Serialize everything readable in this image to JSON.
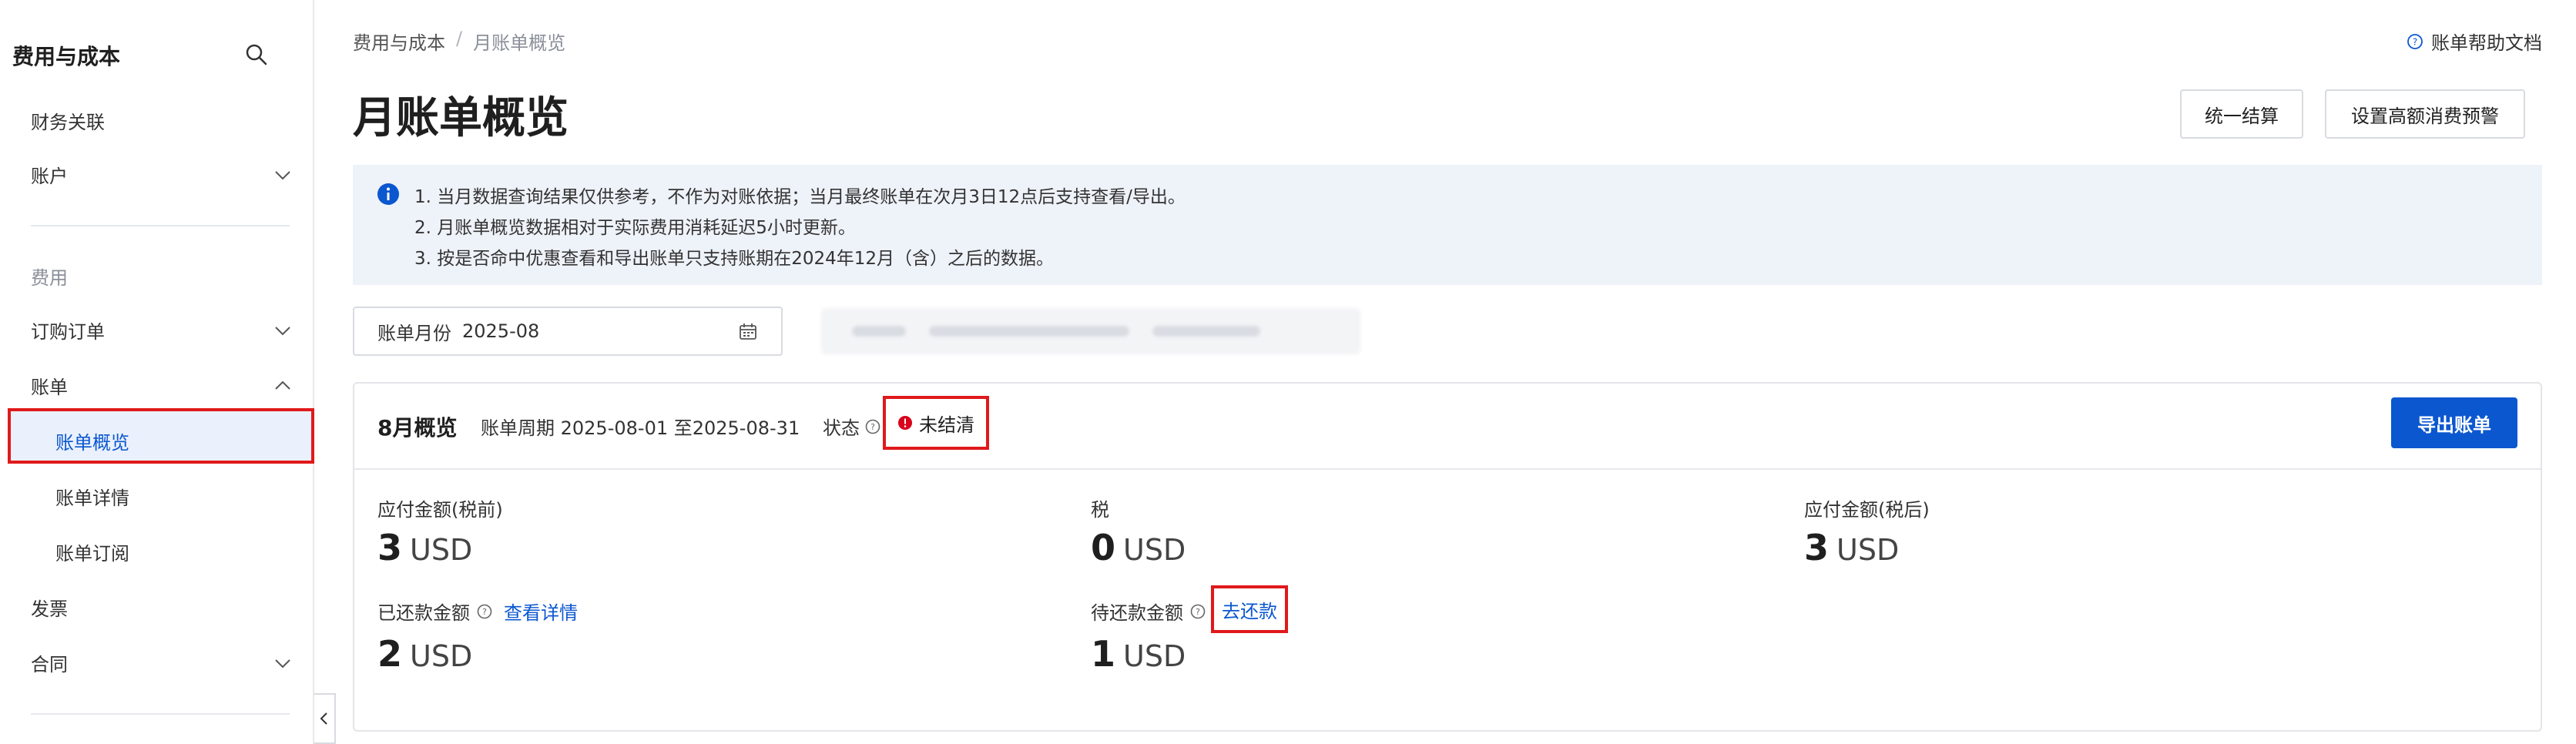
{
  "sidebar": {
    "title": "费用与成本",
    "items": [
      {
        "label": "财务关联"
      },
      {
        "label": "账户"
      },
      {
        "label": "费用"
      },
      {
        "label": "订购订单"
      },
      {
        "label": "账单"
      },
      {
        "label": "账单概览"
      },
      {
        "label": "账单详情"
      },
      {
        "label": "账单订阅"
      },
      {
        "label": "发票"
      },
      {
        "label": "合同"
      }
    ]
  },
  "breadcrumb": {
    "root": "费用与成本",
    "separator": "/",
    "current": "月账单概览"
  },
  "help_link": "账单帮助文档",
  "page_title": "月账单概览",
  "buttons": {
    "settle": "统一结算",
    "alert": "设置高额消费预警",
    "export": "导出账单"
  },
  "notice": {
    "lines": [
      "1. 当月数据查询结果仅供参考，不作为对账依据；当月最终账单在次月3日12点后支持查看/导出。",
      "2. 月账单概览数据相对于实际费用消耗延迟5小时更新。",
      "3. 按是否命中优惠查看和导出账单只支持账期在2024年12月（含）之后的数据。"
    ]
  },
  "month_picker": {
    "label": "账单月份",
    "value": "2025-08"
  },
  "overview": {
    "month": "8月概览",
    "period": "账单周期 2025-08-01 至2025-08-31",
    "status_label": "状态",
    "status_value": "未结清",
    "metrics": {
      "payable_pre_tax": {
        "label": "应付金额(税前)",
        "amount": "3",
        "unit": "USD"
      },
      "tax": {
        "label": "税",
        "amount": "0",
        "unit": "USD"
      },
      "payable_post_tax": {
        "label": "应付金额(税后)",
        "amount": "3",
        "unit": "USD"
      },
      "repaid": {
        "label": "已还款金额",
        "link": "查看详情",
        "amount": "2",
        "unit": "USD"
      },
      "pending": {
        "label": "待还款金额",
        "link": "去还款",
        "amount": "1",
        "unit": "USD"
      }
    }
  },
  "colors": {
    "primary": "#0b57d0",
    "highlight": "#e0191b",
    "notice_bg": "#eef2f9",
    "status_error": "#d9001b"
  }
}
